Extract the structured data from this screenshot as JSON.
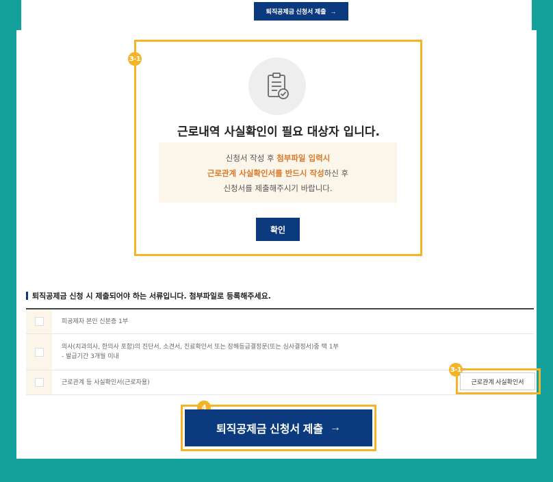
{
  "top_button": {
    "label": "퇴직공제금 신청서 제출",
    "arrow": "→"
  },
  "dialog": {
    "badge": "3-1",
    "icon": "clipboard-check-icon",
    "title": "근로내역 사실확인이 필요 대상자 입니다.",
    "notice": {
      "line1_prefix": "신청서 작성 후 ",
      "line1_highlight": "첨부파일 입력시",
      "line2_highlight": "근로관계 사실확인서를 반드시 작성",
      "line2_suffix": "하신 후",
      "line3": "신청서를 제출해주시기 바랍니다."
    },
    "confirm_label": "확인"
  },
  "section": {
    "title": "퇴직공제금 신청 시 제출되어야 하는 서류입니다. 첨부파일로 등록해주세요."
  },
  "documents": [
    {
      "text": "피공제자 본인 신분증 1부",
      "subtext": ""
    },
    {
      "text": "의사(치과의사, 한의사 포함)의 진단서, 소견서, 진료확인서 또는 장해등급결정문(또는 심사결정서)중 택 1부",
      "subtext": "- 발급기간 3개월 이내"
    },
    {
      "text": "근로관계 등 사실확인서(근로자용)",
      "subtext": ""
    }
  ],
  "cert_button": {
    "badge": "3-1",
    "label": "근로관계 사실확인서"
  },
  "submit_button": {
    "badge": "4",
    "label": "퇴직공제금 신청서 제출",
    "arrow": "→"
  },
  "colors": {
    "background": "#14a19c",
    "primary": "#0b3a7e",
    "highlight": "#f5b428",
    "accent_text": "#d9782a",
    "notice_bg": "#fcf6ea"
  }
}
